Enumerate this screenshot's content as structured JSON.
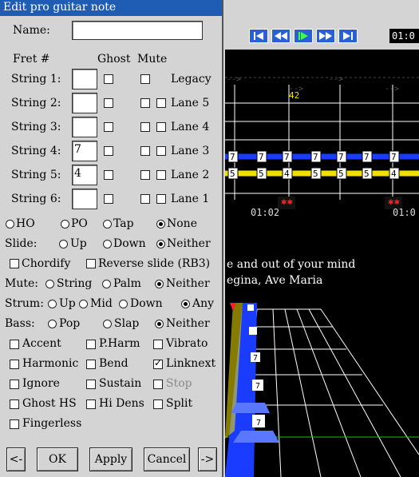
{
  "dialog": {
    "title": "Edit pro guitar note",
    "name_label": "Name:",
    "name_value": "",
    "fret_header": "Fret #",
    "ghost_header": "Ghost",
    "mute_header": "Mute",
    "strings": [
      {
        "label": "String 1:",
        "fret": "",
        "ghost": false,
        "mute": false,
        "lane": null,
        "lane_label": "Legacy",
        "lane_checked": false
      },
      {
        "label": "String 2:",
        "fret": "",
        "ghost": false,
        "mute": false,
        "lane_label": "Lane 5",
        "lane_checked": false
      },
      {
        "label": "String 3:",
        "fret": "",
        "ghost": false,
        "mute": false,
        "lane_label": "Lane 4",
        "lane_checked": false
      },
      {
        "label": "String 4:",
        "fret": "7",
        "ghost": false,
        "mute": false,
        "lane_label": "Lane 3",
        "lane_checked": false
      },
      {
        "label": "String 5:",
        "fret": "4",
        "ghost": false,
        "mute": false,
        "lane_label": "Lane 2",
        "lane_checked": false
      },
      {
        "label": "String 6:",
        "fret": "",
        "ghost": false,
        "mute": false,
        "lane_label": "Lane 1",
        "lane_checked": false
      }
    ],
    "technique": {
      "options": [
        "HO",
        "PO",
        "Tap",
        "None"
      ],
      "selected": "None"
    },
    "slide": {
      "label": "Slide:",
      "options": [
        "Up",
        "Down",
        "Neither"
      ],
      "selected": "Neither"
    },
    "chordify": "Chordify",
    "reverse_slide": "Reverse slide (RB3)",
    "mute": {
      "label": "Mute:",
      "options": [
        "String",
        "Palm",
        "Neither"
      ],
      "selected": "Neither"
    },
    "strum": {
      "label": "Strum:",
      "options": [
        "Up",
        "Mid",
        "Down",
        "Any"
      ],
      "selected": "Any"
    },
    "bass": {
      "label": "Bass:",
      "options": [
        "Pop",
        "Slap",
        "Neither"
      ],
      "selected": "Neither"
    },
    "flags": [
      {
        "label": "Accent",
        "checked": false
      },
      {
        "label": "P.Harm",
        "checked": false
      },
      {
        "label": "Vibrato",
        "checked": false
      },
      {
        "label": "Harmonic",
        "checked": false
      },
      {
        "label": "Bend",
        "checked": false
      },
      {
        "label": "Linknext",
        "checked": true
      },
      {
        "label": "Ignore",
        "checked": false
      },
      {
        "label": "Sustain",
        "checked": false
      },
      {
        "label": "Stop",
        "checked": false
      },
      {
        "label": "Ghost HS",
        "checked": false
      },
      {
        "label": "Hi Dens",
        "checked": false
      },
      {
        "label": "Split",
        "checked": false
      },
      {
        "label": "Fingerless",
        "checked": false
      }
    ],
    "buttons": {
      "prev": "<-",
      "ok": "OK",
      "apply": "Apply",
      "cancel": "Cancel",
      "next": "->"
    }
  },
  "editor": {
    "time_display": "01:0",
    "measure_number": "42",
    "timeline_labels": [
      "01:02",
      "01:0"
    ],
    "lyrics_line1": "e and out of your mind",
    "lyrics_line2": "egina, Ave Maria",
    "fret_note_values": [
      "7",
      "5",
      "4"
    ],
    "colors": {
      "string_blue": "#1a3cff",
      "string_yellow": "#f0e000",
      "dialog_title": "#1f5db5",
      "transport": "#2860d8"
    }
  }
}
